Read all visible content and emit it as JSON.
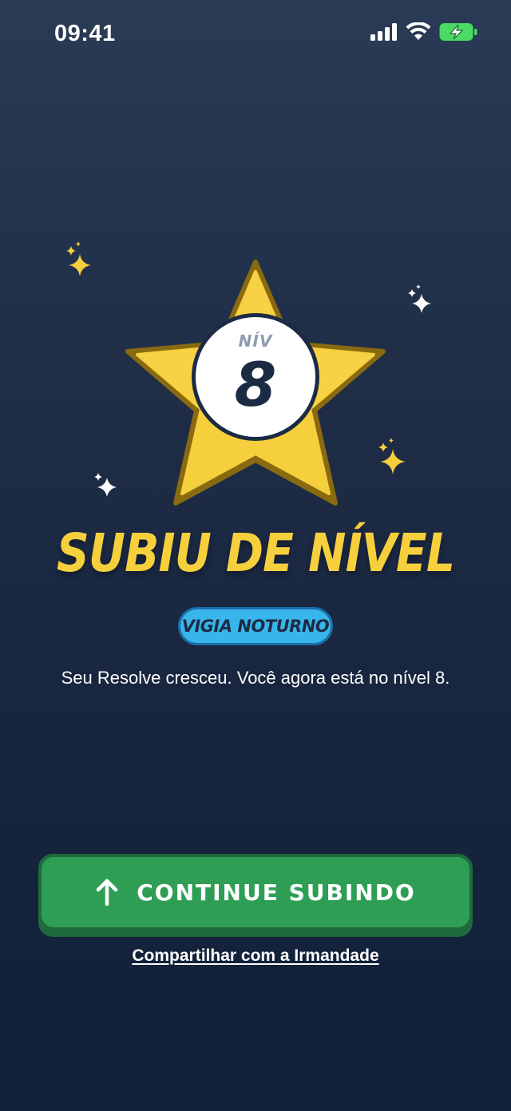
{
  "status_bar": {
    "time": "09:41",
    "icons": [
      "cellular-signal-icon",
      "wifi-icon",
      "battery-charging-icon"
    ],
    "battery_color": "#4cd964"
  },
  "level_up": {
    "level_prefix": "NÍV",
    "level_number": "8",
    "headline": "SUBIU DE NÍVEL",
    "rank_title": "VIGIA NOTURNO",
    "message": "Seu Resolve cresceu. Você agora está no nível 8."
  },
  "actions": {
    "continue_label": "CONTINUE SUBINDO",
    "continue_icon": "arrow-up-icon",
    "share_label": "Compartilhar com a Irmandade"
  },
  "colors": {
    "background_top": "#2a3b55",
    "background_bottom": "#112038",
    "star": "#f6cf3d",
    "star_outline": "#8a6a10",
    "badge": "#38b6ec",
    "button": "#2f9e55",
    "button_shadow": "#1f6a3b"
  }
}
